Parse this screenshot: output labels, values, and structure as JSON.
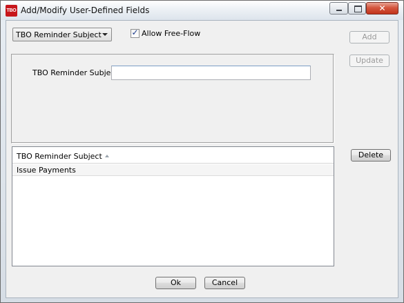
{
  "window": {
    "title": "Add/Modify User-Defined Fields",
    "app_icon_text": "TBO",
    "close_glyph": "✕"
  },
  "field_selector": {
    "selected": "TBO Reminder Subject"
  },
  "allow_free_flow": {
    "label": "Allow Free-Flow",
    "checked": true,
    "check_glyph": "✓"
  },
  "buttons": {
    "add": "Add",
    "update": "Update",
    "delete": "Delete",
    "ok": "Ok",
    "cancel": "Cancel"
  },
  "form": {
    "field_label": "TBO Reminder Subject",
    "field_value": ""
  },
  "table": {
    "columns": [
      {
        "header": "TBO Reminder Subject",
        "sort": "ascending"
      }
    ],
    "rows": [
      {
        "value": "Issue Payments"
      }
    ]
  },
  "colors": {
    "app_icon": "#c7161b",
    "close_button": "#c2341c",
    "check_mark": "#1c3c8c"
  }
}
